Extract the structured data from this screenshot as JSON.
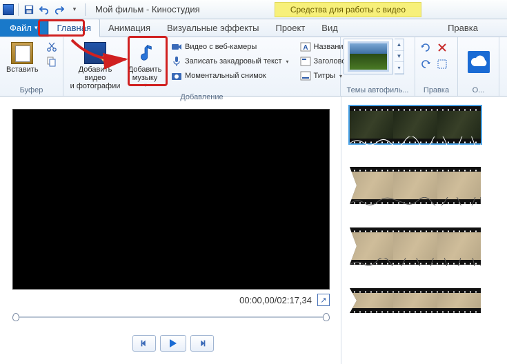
{
  "titlebar": {
    "title": "Мой фильм - Киностудия",
    "contextual_label": "Средства для работы с видео"
  },
  "tabs": {
    "file": "Файл",
    "home": "Главная",
    "animation": "Анимация",
    "effects": "Визуальные эффекты",
    "project": "Проект",
    "view": "Вид",
    "edit": "Правка"
  },
  "ribbon": {
    "clipboard": {
      "label": "Буфер",
      "paste": "Вставить"
    },
    "add": {
      "label": "Добавление",
      "add_video": "Добавить видео\nи фотографии",
      "add_music": "Добавить\nмузыку",
      "webcam": "Видео с веб-камеры",
      "narration": "Записать закадровый текст",
      "snapshot": "Моментальный снимок",
      "title": "Название",
      "heading": "Заголовок",
      "captions": "Титры"
    },
    "themes": {
      "label": "Темы автофиль..."
    },
    "edit": {
      "label": "Правка"
    },
    "share": {
      "label": "О..."
    }
  },
  "preview": {
    "time": "00:00,00/02:17,34"
  }
}
